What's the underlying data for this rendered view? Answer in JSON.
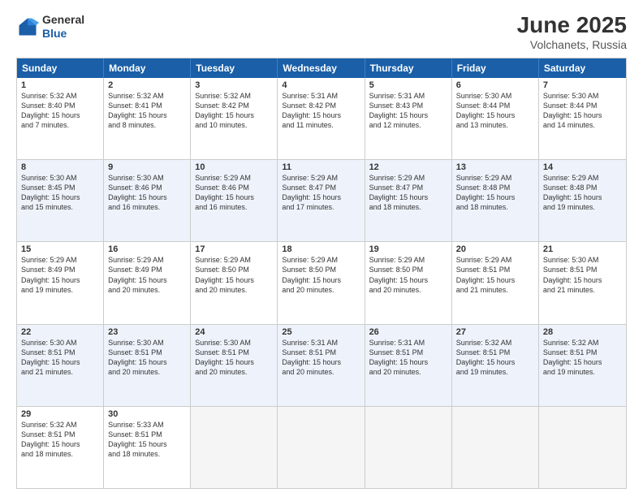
{
  "logo": {
    "general": "General",
    "blue": "Blue"
  },
  "title": {
    "month": "June 2025",
    "location": "Volchanets, Russia"
  },
  "header_days": [
    "Sunday",
    "Monday",
    "Tuesday",
    "Wednesday",
    "Thursday",
    "Friday",
    "Saturday"
  ],
  "rows": [
    {
      "alt": false,
      "cells": [
        {
          "day": "1",
          "lines": [
            "Sunrise: 5:32 AM",
            "Sunset: 8:40 PM",
            "Daylight: 15 hours",
            "and 7 minutes."
          ]
        },
        {
          "day": "2",
          "lines": [
            "Sunrise: 5:32 AM",
            "Sunset: 8:41 PM",
            "Daylight: 15 hours",
            "and 8 minutes."
          ]
        },
        {
          "day": "3",
          "lines": [
            "Sunrise: 5:32 AM",
            "Sunset: 8:42 PM",
            "Daylight: 15 hours",
            "and 10 minutes."
          ]
        },
        {
          "day": "4",
          "lines": [
            "Sunrise: 5:31 AM",
            "Sunset: 8:42 PM",
            "Daylight: 15 hours",
            "and 11 minutes."
          ]
        },
        {
          "day": "5",
          "lines": [
            "Sunrise: 5:31 AM",
            "Sunset: 8:43 PM",
            "Daylight: 15 hours",
            "and 12 minutes."
          ]
        },
        {
          "day": "6",
          "lines": [
            "Sunrise: 5:30 AM",
            "Sunset: 8:44 PM",
            "Daylight: 15 hours",
            "and 13 minutes."
          ]
        },
        {
          "day": "7",
          "lines": [
            "Sunrise: 5:30 AM",
            "Sunset: 8:44 PM",
            "Daylight: 15 hours",
            "and 14 minutes."
          ]
        }
      ]
    },
    {
      "alt": true,
      "cells": [
        {
          "day": "8",
          "lines": [
            "Sunrise: 5:30 AM",
            "Sunset: 8:45 PM",
            "Daylight: 15 hours",
            "and 15 minutes."
          ]
        },
        {
          "day": "9",
          "lines": [
            "Sunrise: 5:30 AM",
            "Sunset: 8:46 PM",
            "Daylight: 15 hours",
            "and 16 minutes."
          ]
        },
        {
          "day": "10",
          "lines": [
            "Sunrise: 5:29 AM",
            "Sunset: 8:46 PM",
            "Daylight: 15 hours",
            "and 16 minutes."
          ]
        },
        {
          "day": "11",
          "lines": [
            "Sunrise: 5:29 AM",
            "Sunset: 8:47 PM",
            "Daylight: 15 hours",
            "and 17 minutes."
          ]
        },
        {
          "day": "12",
          "lines": [
            "Sunrise: 5:29 AM",
            "Sunset: 8:47 PM",
            "Daylight: 15 hours",
            "and 18 minutes."
          ]
        },
        {
          "day": "13",
          "lines": [
            "Sunrise: 5:29 AM",
            "Sunset: 8:48 PM",
            "Daylight: 15 hours",
            "and 18 minutes."
          ]
        },
        {
          "day": "14",
          "lines": [
            "Sunrise: 5:29 AM",
            "Sunset: 8:48 PM",
            "Daylight: 15 hours",
            "and 19 minutes."
          ]
        }
      ]
    },
    {
      "alt": false,
      "cells": [
        {
          "day": "15",
          "lines": [
            "Sunrise: 5:29 AM",
            "Sunset: 8:49 PM",
            "Daylight: 15 hours",
            "and 19 minutes."
          ]
        },
        {
          "day": "16",
          "lines": [
            "Sunrise: 5:29 AM",
            "Sunset: 8:49 PM",
            "Daylight: 15 hours",
            "and 20 minutes."
          ]
        },
        {
          "day": "17",
          "lines": [
            "Sunrise: 5:29 AM",
            "Sunset: 8:50 PM",
            "Daylight: 15 hours",
            "and 20 minutes."
          ]
        },
        {
          "day": "18",
          "lines": [
            "Sunrise: 5:29 AM",
            "Sunset: 8:50 PM",
            "Daylight: 15 hours",
            "and 20 minutes."
          ]
        },
        {
          "day": "19",
          "lines": [
            "Sunrise: 5:29 AM",
            "Sunset: 8:50 PM",
            "Daylight: 15 hours",
            "and 20 minutes."
          ]
        },
        {
          "day": "20",
          "lines": [
            "Sunrise: 5:29 AM",
            "Sunset: 8:51 PM",
            "Daylight: 15 hours",
            "and 21 minutes."
          ]
        },
        {
          "day": "21",
          "lines": [
            "Sunrise: 5:30 AM",
            "Sunset: 8:51 PM",
            "Daylight: 15 hours",
            "and 21 minutes."
          ]
        }
      ]
    },
    {
      "alt": true,
      "cells": [
        {
          "day": "22",
          "lines": [
            "Sunrise: 5:30 AM",
            "Sunset: 8:51 PM",
            "Daylight: 15 hours",
            "and 21 minutes."
          ]
        },
        {
          "day": "23",
          "lines": [
            "Sunrise: 5:30 AM",
            "Sunset: 8:51 PM",
            "Daylight: 15 hours",
            "and 20 minutes."
          ]
        },
        {
          "day": "24",
          "lines": [
            "Sunrise: 5:30 AM",
            "Sunset: 8:51 PM",
            "Daylight: 15 hours",
            "and 20 minutes."
          ]
        },
        {
          "day": "25",
          "lines": [
            "Sunrise: 5:31 AM",
            "Sunset: 8:51 PM",
            "Daylight: 15 hours",
            "and 20 minutes."
          ]
        },
        {
          "day": "26",
          "lines": [
            "Sunrise: 5:31 AM",
            "Sunset: 8:51 PM",
            "Daylight: 15 hours",
            "and 20 minutes."
          ]
        },
        {
          "day": "27",
          "lines": [
            "Sunrise: 5:32 AM",
            "Sunset: 8:51 PM",
            "Daylight: 15 hours",
            "and 19 minutes."
          ]
        },
        {
          "day": "28",
          "lines": [
            "Sunrise: 5:32 AM",
            "Sunset: 8:51 PM",
            "Daylight: 15 hours",
            "and 19 minutes."
          ]
        }
      ]
    },
    {
      "alt": false,
      "cells": [
        {
          "day": "29",
          "lines": [
            "Sunrise: 5:32 AM",
            "Sunset: 8:51 PM",
            "Daylight: 15 hours",
            "and 18 minutes."
          ]
        },
        {
          "day": "30",
          "lines": [
            "Sunrise: 5:33 AM",
            "Sunset: 8:51 PM",
            "Daylight: 15 hours",
            "and 18 minutes."
          ]
        },
        {
          "day": "",
          "lines": []
        },
        {
          "day": "",
          "lines": []
        },
        {
          "day": "",
          "lines": []
        },
        {
          "day": "",
          "lines": []
        },
        {
          "day": "",
          "lines": []
        }
      ]
    }
  ]
}
